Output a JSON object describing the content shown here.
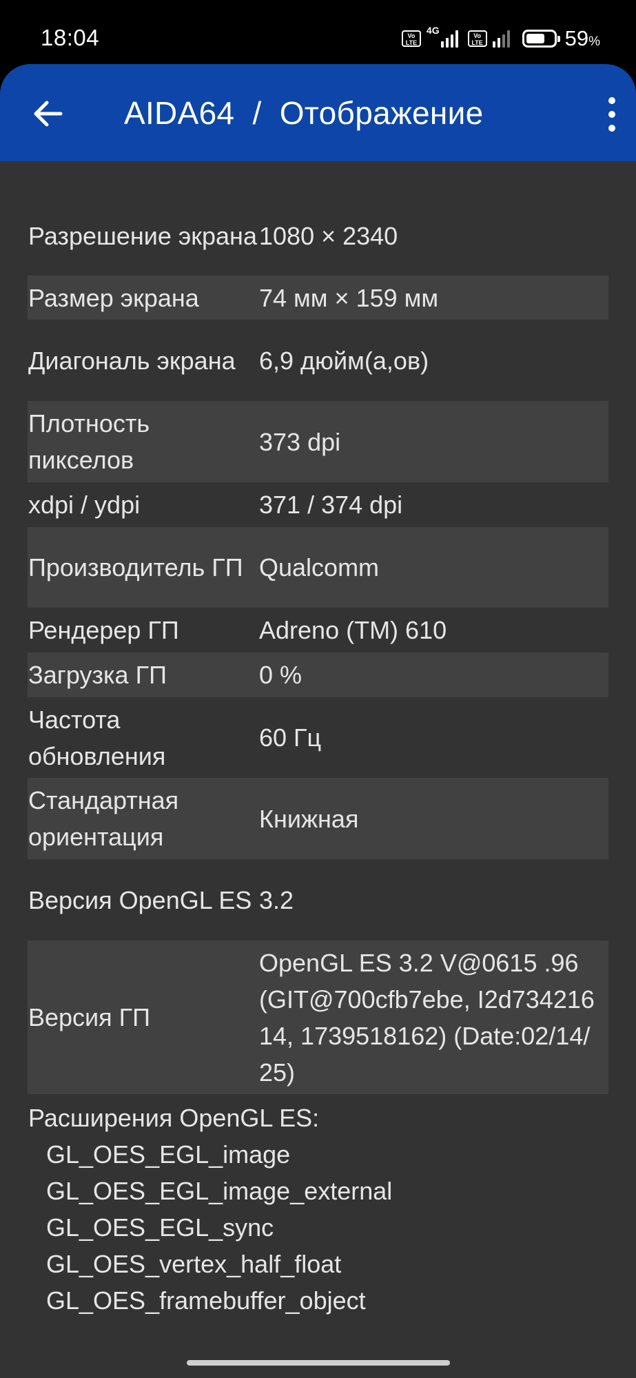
{
  "status_bar": {
    "time": "18:04",
    "network_type": "4G",
    "volte_label": "Vo LTE",
    "battery_percent": "59",
    "battery_unit": "%"
  },
  "app_bar": {
    "title": "AIDA64  /  Отображение",
    "accent_color": "#0d46a8"
  },
  "rows": [
    {
      "label": "Разрешение экрана",
      "value": "1080 × 2340"
    },
    {
      "label": "Размер экрана",
      "value": "74 мм × 159 мм"
    },
    {
      "label": "Диагональ экрана",
      "value": "6,9 дюйм(а,ов)"
    },
    {
      "label": "Плотность пикселов",
      "value": "373 dpi"
    },
    {
      "label": "xdpi / ydpi",
      "value": "371 / 374 dpi"
    },
    {
      "label": "Производитель ГП",
      "value": "Qualcomm"
    },
    {
      "label": "Рендерер ГП",
      "value": "Adreno (TM) 610"
    },
    {
      "label": "Загрузка ГП",
      "value": "0 %"
    },
    {
      "label": "Частота обновления",
      "value": "60 Гц"
    },
    {
      "label": "Стандартная ориентация",
      "value": "Книжная"
    },
    {
      "label": "Версия OpenGL ES",
      "value": "3.2"
    },
    {
      "label": "Версия ГП",
      "value": "OpenGL ES 3.2 V@0615 .96 (GIT@700cfb7ebe, I2d73421614, 1739518162) (Date:02/14/25)"
    }
  ],
  "extensions": {
    "title": "Расширения OpenGL ES:",
    "items": [
      "GL_OES_EGL_image",
      "GL_OES_EGL_image_external",
      "GL_OES_EGL_sync",
      "GL_OES_vertex_half_float",
      "GL_OES_framebuffer_object"
    ]
  }
}
